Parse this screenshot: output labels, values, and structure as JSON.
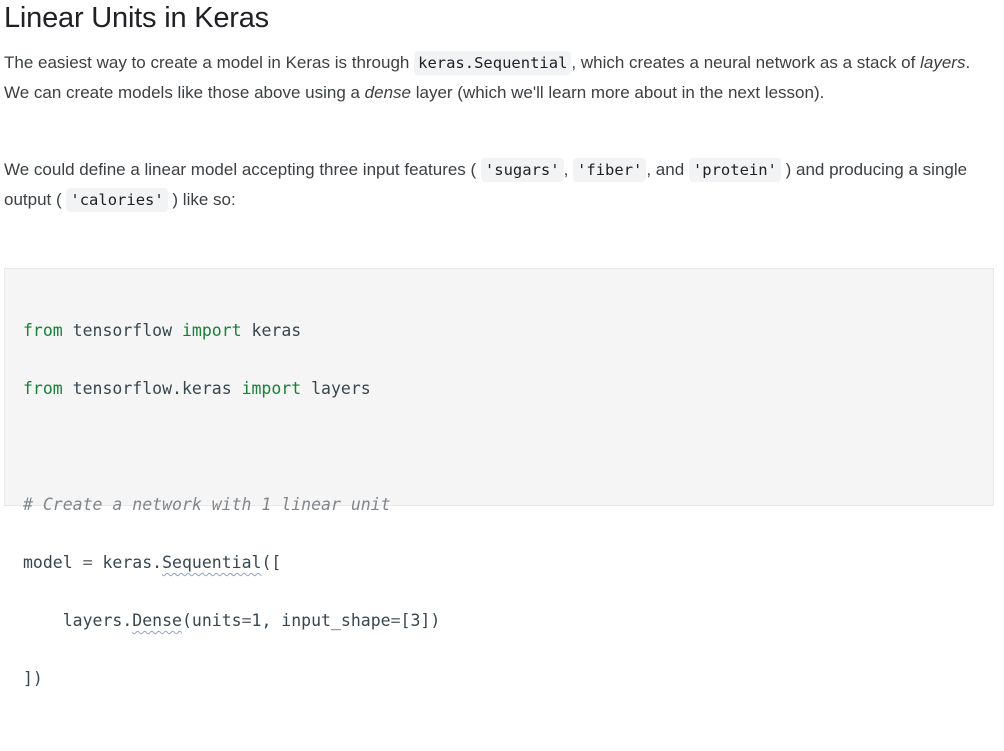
{
  "heading": "Linear Units in Keras",
  "paragraph1": {
    "t1": "The easiest way to create a model in Keras is through ",
    "code1": "keras.Sequential",
    "t2": ", which creates a neural network as a stack of ",
    "em1": "layers",
    "t3": ". We can create models like those above using a ",
    "em2": "dense",
    "t4": " layer (which we'll learn more about in the next lesson)."
  },
  "paragraph2": {
    "t1": "We could define a linear model accepting three input features ( ",
    "code1": "'sugars'",
    "t2": ", ",
    "code2": "'fiber'",
    "t3": ", and ",
    "code3": "'protein'",
    "t4": " ) and producing a single output ( ",
    "code4": "'calories'",
    "t5": " ) like so:"
  },
  "code": {
    "l1_kw1": "from",
    "l1_mid": " tensorflow ",
    "l1_kw2": "import",
    "l1_end": " keras",
    "l2_kw1": "from",
    "l2_mid": " tensorflow.keras ",
    "l2_kw2": "import",
    "l2_end": " layers",
    "l4_comment": "# Create a network with 1 linear unit",
    "l5_a": "model ",
    "l5_eq": "=",
    "l5_b": " keras.",
    "l5_fn": "Sequential",
    "l5_c": "([",
    "l6_a": "    layers.",
    "l6_fn": "Dense",
    "l6_b": "(units",
    "l6_eq1": "=",
    "l6_n1": "1",
    "l6_c": ", input_shape",
    "l6_eq2": "=",
    "l6_d": "[3])",
    "l7": "])"
  }
}
